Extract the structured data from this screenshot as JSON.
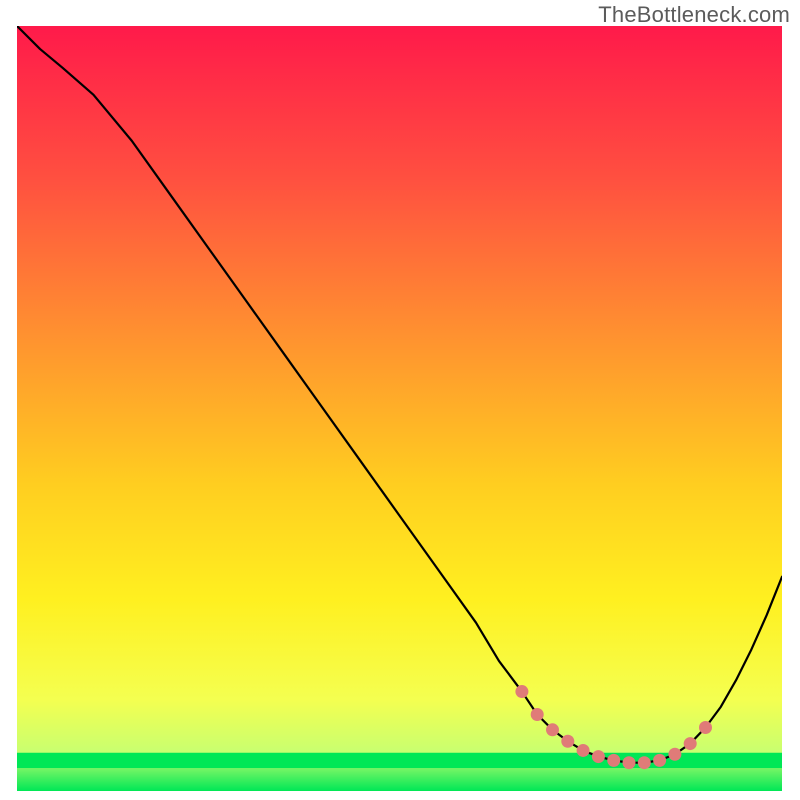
{
  "watermark": "TheBottleneck.com",
  "chart_data": {
    "type": "line",
    "title": "",
    "xlabel": "",
    "ylabel": "",
    "xlim": [
      0,
      100
    ],
    "ylim": [
      0,
      100
    ],
    "x": [
      0,
      3,
      6,
      10,
      15,
      20,
      25,
      30,
      35,
      40,
      45,
      50,
      55,
      60,
      63,
      66,
      68,
      70,
      72,
      74,
      76,
      78,
      80,
      82,
      84,
      86,
      88,
      90,
      92,
      94,
      96,
      98,
      100
    ],
    "y": [
      100,
      97,
      94.5,
      91,
      85,
      78,
      71,
      64,
      57,
      50,
      43,
      36,
      29,
      22,
      17,
      13,
      10,
      8,
      6.5,
      5.3,
      4.5,
      4,
      3.7,
      3.7,
      4,
      4.8,
      6.2,
      8.3,
      11,
      14.5,
      18.5,
      23,
      28
    ],
    "optimal_zone": {
      "x": [
        66,
        68,
        70,
        72,
        74,
        76,
        78,
        80,
        82,
        84,
        86,
        88,
        90
      ],
      "y": [
        13,
        10,
        8,
        6.5,
        5.3,
        4.5,
        4,
        3.7,
        3.7,
        4,
        4.8,
        6.2,
        8.3
      ]
    },
    "green_band_y": 3.0,
    "green_band_height": 2.0,
    "gradient_stops": [
      {
        "offset": 0,
        "color": "#ff1a4a"
      },
      {
        "offset": 20,
        "color": "#ff5040"
      },
      {
        "offset": 40,
        "color": "#ff9030"
      },
      {
        "offset": 60,
        "color": "#ffce20"
      },
      {
        "offset": 75,
        "color": "#fff020"
      },
      {
        "offset": 88,
        "color": "#f4ff50"
      },
      {
        "offset": 95,
        "color": "#c8ff70"
      },
      {
        "offset": 100,
        "color": "#00e756"
      }
    ]
  }
}
